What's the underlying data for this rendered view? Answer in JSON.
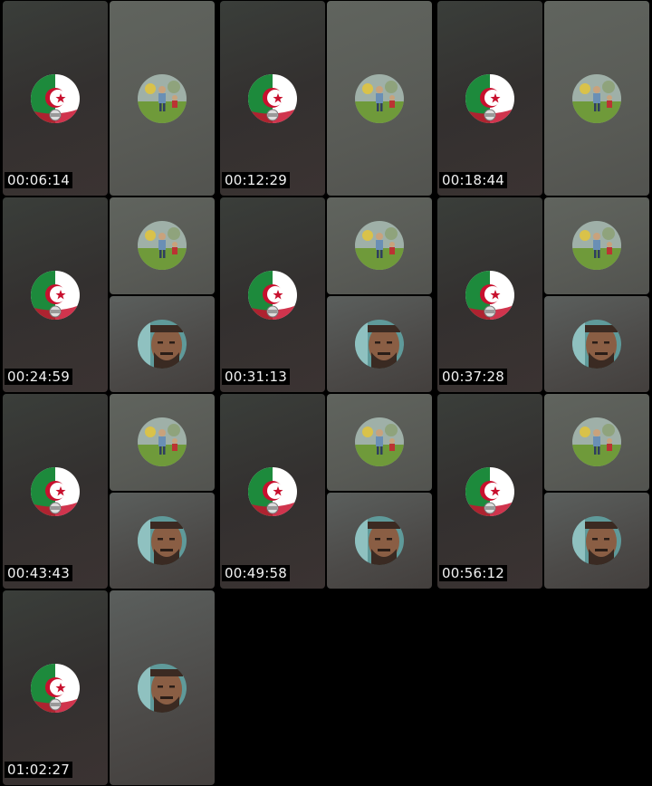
{
  "grid": {
    "frames": [
      {
        "timestamp": "00:06:14",
        "participants": [
          "algeria-flag-avatar",
          "boy-field-avatar"
        ]
      },
      {
        "timestamp": "00:12:29",
        "participants": [
          "algeria-flag-avatar",
          "boy-field-avatar"
        ]
      },
      {
        "timestamp": "00:18:44",
        "participants": [
          "algeria-flag-avatar",
          "boy-field-avatar"
        ]
      },
      {
        "timestamp": "00:24:59",
        "participants": [
          "algeria-flag-avatar",
          "boy-field-avatar",
          "bearded-man-avatar"
        ]
      },
      {
        "timestamp": "00:31:13",
        "participants": [
          "algeria-flag-avatar",
          "boy-field-avatar",
          "bearded-man-avatar"
        ]
      },
      {
        "timestamp": "00:37:28",
        "participants": [
          "algeria-flag-avatar",
          "boy-field-avatar",
          "bearded-man-avatar"
        ]
      },
      {
        "timestamp": "00:43:43",
        "participants": [
          "algeria-flag-avatar",
          "boy-field-avatar",
          "bearded-man-avatar"
        ]
      },
      {
        "timestamp": "00:49:58",
        "participants": [
          "algeria-flag-avatar",
          "boy-field-avatar",
          "bearded-man-avatar"
        ]
      },
      {
        "timestamp": "00:56:12",
        "participants": [
          "algeria-flag-avatar",
          "boy-field-avatar",
          "bearded-man-avatar"
        ]
      },
      {
        "timestamp": "01:02:27",
        "participants": [
          "algeria-flag-avatar",
          "bearded-man-avatar"
        ]
      }
    ]
  }
}
